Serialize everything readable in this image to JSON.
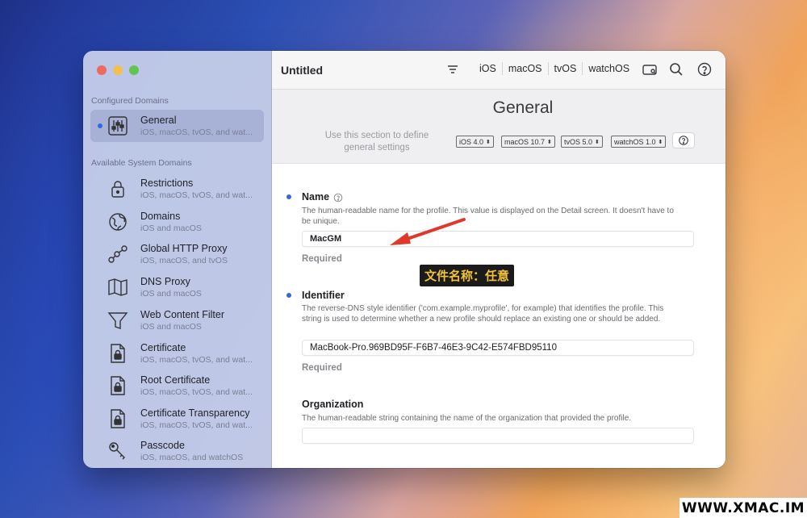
{
  "window": {
    "title": "Untitled"
  },
  "toolbar": {
    "platforms": [
      "iOS",
      "macOS",
      "tvOS",
      "watchOS"
    ],
    "icons": [
      "filter-icon",
      "preview-icon",
      "search-icon",
      "help-icon"
    ]
  },
  "sidebar": {
    "configured_label": "Configured Domains",
    "available_label": "Available System Domains",
    "configured": [
      {
        "title": "General",
        "subtitle": "iOS, macOS, tvOS, and wat...",
        "icon": "sliders-icon"
      }
    ],
    "available": [
      {
        "title": "Restrictions",
        "subtitle": "iOS, macOS, tvOS, and wat...",
        "icon": "lock-icon"
      },
      {
        "title": "Domains",
        "subtitle": "iOS and macOS",
        "icon": "globe-icon"
      },
      {
        "title": "Global HTTP Proxy",
        "subtitle": "iOS, macOS, and tvOS",
        "icon": "network-nodes-icon"
      },
      {
        "title": "DNS Proxy",
        "subtitle": "iOS and macOS",
        "icon": "map-icon"
      },
      {
        "title": "Web Content Filter",
        "subtitle": "iOS and macOS",
        "icon": "funnel-icon"
      },
      {
        "title": "Certificate",
        "subtitle": "iOS, macOS, tvOS, and wat...",
        "icon": "locked-document-icon"
      },
      {
        "title": "Root Certificate",
        "subtitle": "iOS, macOS, tvOS, and wat...",
        "icon": "locked-document-icon"
      },
      {
        "title": "Certificate Transparency",
        "subtitle": "iOS, macOS, tvOS, and wat...",
        "icon": "locked-document-icon"
      },
      {
        "title": "Passcode",
        "subtitle": "iOS, macOS, and watchOS",
        "icon": "key-icon"
      }
    ]
  },
  "header": {
    "title": "General",
    "description": "Use this section to define general settings",
    "versions": [
      "iOS  4.0",
      "macOS  10.7",
      "tvOS  5.0",
      "watchOS  1.0"
    ]
  },
  "fields": {
    "name": {
      "label": "Name",
      "description": "The human-readable name for the profile. This value is displayed on the Detail screen. It doesn't have to be unique.",
      "value": "MacGM",
      "required": "Required"
    },
    "identifier": {
      "label": "Identifier",
      "description": "The reverse-DNS style identifier ('com.example.myprofile', for example) that identifies the profile. This string is used to determine whether a new profile should replace an existing one or should be added.",
      "value": "MacBook-Pro.969BD95F-F6B7-46E3-9C42-E574FBD95110",
      "required": "Required"
    },
    "organization": {
      "label": "Organization",
      "description": "The human-readable string containing the name of the organization that provided the profile.",
      "value": ""
    }
  },
  "annotation": {
    "text": "文件名称：任意",
    "color": "#f2c33a"
  },
  "watermark": "WWW.XMAC.IM",
  "colors": {
    "accent": "#3468d8",
    "selection": "#2f6ae0"
  }
}
